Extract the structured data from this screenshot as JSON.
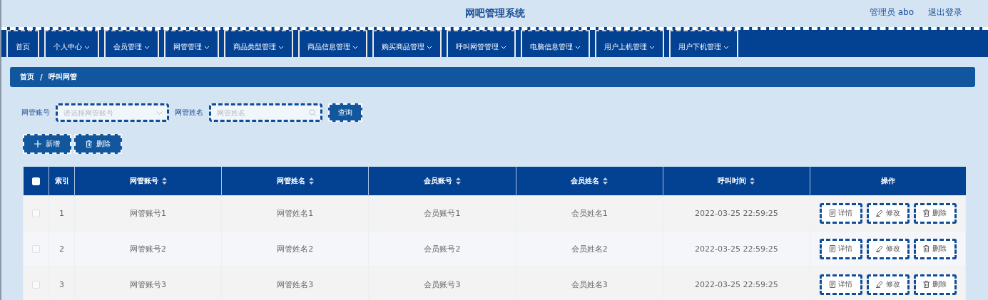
{
  "header": {
    "title": "网吧管理系统",
    "user": "管理员 abo",
    "logout": "退出登录"
  },
  "nav": [
    {
      "label": "首页",
      "dropdown": false
    },
    {
      "label": "个人中心",
      "dropdown": true
    },
    {
      "label": "会员管理",
      "dropdown": true
    },
    {
      "label": "网管管理",
      "dropdown": true
    },
    {
      "label": "商品类型管理",
      "dropdown": true
    },
    {
      "label": "商品信息管理",
      "dropdown": true
    },
    {
      "label": "购买商品管理",
      "dropdown": true
    },
    {
      "label": "呼叫网管管理",
      "dropdown": true
    },
    {
      "label": "电脑信息管理",
      "dropdown": true
    },
    {
      "label": "用户上机管理",
      "dropdown": true
    },
    {
      "label": "用户下机管理",
      "dropdown": true
    }
  ],
  "breadcrumb": {
    "items": [
      "首页",
      "呼叫网管"
    ],
    "separator": "/"
  },
  "search": {
    "account_label": "网管账号",
    "account_placeholder": "请选择网管账号",
    "name_label": "网管姓名",
    "name_placeholder": "网管姓名",
    "query_button": "查询"
  },
  "actions": [
    {
      "kind": "add",
      "label": "新增"
    },
    {
      "kind": "delete",
      "label": "删除"
    }
  ],
  "table": {
    "select_all_checked": false,
    "columns": [
      {
        "label": "索引",
        "sortable": false
      },
      {
        "label": "网管账号",
        "sortable": true
      },
      {
        "label": "网管姓名",
        "sortable": true
      },
      {
        "label": "会员账号",
        "sortable": true
      },
      {
        "label": "会员姓名",
        "sortable": true
      },
      {
        "label": "呼叫时间",
        "sortable": true
      },
      {
        "label": "操作",
        "sortable": false
      }
    ],
    "rows": [
      {
        "checked": false,
        "cells": [
          "1",
          "网管账号1",
          "网管姓名1",
          "会员账号1",
          "会员姓名1",
          "2022-03-25 22:59:25"
        ],
        "actions": [
          {
            "kind": "detail",
            "label": "详情"
          },
          {
            "kind": "edit",
            "label": "修改"
          },
          {
            "kind": "delete",
            "label": "删除"
          }
        ]
      },
      {
        "checked": false,
        "cells": [
          "2",
          "网管账号2",
          "网管姓名2",
          "会员账号2",
          "会员姓名2",
          "2022-03-25 22:59:25"
        ],
        "actions": [
          {
            "kind": "detail",
            "label": "详情"
          },
          {
            "kind": "edit",
            "label": "修改"
          },
          {
            "kind": "delete",
            "label": "删除"
          }
        ]
      },
      {
        "checked": false,
        "cells": [
          "3",
          "网管账号3",
          "网管姓名3",
          "会员账号3",
          "会员姓名3",
          "2022-03-25 22:59:25"
        ],
        "actions": [
          {
            "kind": "detail",
            "label": "详情"
          },
          {
            "kind": "edit",
            "label": "修改"
          },
          {
            "kind": "delete",
            "label": "删除"
          }
        ]
      }
    ]
  }
}
